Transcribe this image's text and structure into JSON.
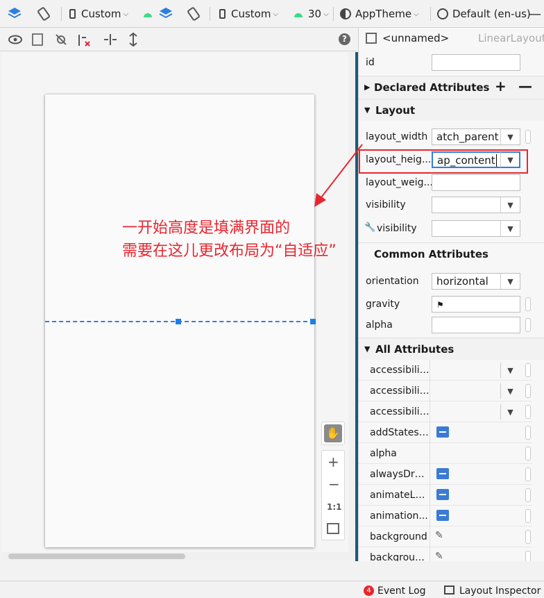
{
  "toolbar": {
    "custom_a": "Custom",
    "custom_b": "Custom",
    "api": "30",
    "theme": "AppTheme",
    "locale": "Default (en-us)"
  },
  "help": "?",
  "properties": {
    "header_name": "<unnamed>",
    "header_type": "LinearLayout",
    "id_label": "id",
    "declared": "Declared Attributes",
    "layout_section": "Layout",
    "layout_width_label": "layout_width",
    "layout_width_value": "atch_parent",
    "layout_height_label": "layout_heig...",
    "layout_height_value": "ap_content",
    "layout_weight_label": "layout_weig...",
    "visibility_label": "visibility",
    "visibility2_label": "visibility",
    "common": "Common Attributes",
    "orientation_label": "orientation",
    "orientation_value": "horizontal",
    "gravity_label": "gravity",
    "alpha_label": "alpha",
    "all": "All Attributes",
    "all_rows": [
      "accessibilit...",
      "accessibilit...",
      "accessibilit...",
      "addStatesF...",
      "alpha",
      "alwaysDra...",
      "animateLa...",
      "animation...",
      "background",
      "backgroun..."
    ]
  },
  "zoom": {
    "ratio": "1:1"
  },
  "annotation": {
    "line1": "一开始高度是填满界面的",
    "line2": "需要在这儿更改布局为“自适应”"
  },
  "status": {
    "event_count": "4",
    "event_log": "Event Log",
    "layout_inspector": "Layout Inspector"
  },
  "colors": {
    "accent": "#1e7de8",
    "annotation": "#e8262f",
    "android": "#3ddc84"
  }
}
